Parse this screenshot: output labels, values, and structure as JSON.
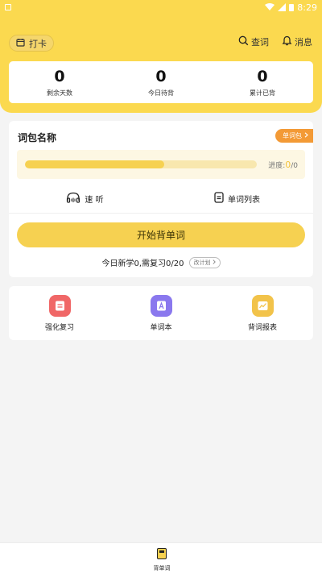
{
  "status_bar": {
    "time": "8:29"
  },
  "header": {
    "checkin_label": "打卡",
    "search_label": "查词",
    "messages_label": "消息",
    "stats": [
      {
        "value": "0",
        "label": "剩余天数"
      },
      {
        "value": "0",
        "label": "今日待背"
      },
      {
        "value": "0",
        "label": "累计已背"
      }
    ]
  },
  "wordbook": {
    "title": "词包名称",
    "tag_label": "单词包",
    "progress_label": "进度:",
    "progress_current": "0",
    "progress_total": "/0",
    "progress_fraction": 0.6,
    "listen_label": "速 听",
    "word_list_label": "单词列表",
    "start_label": "开始背单词",
    "plan_text": "今日新学0,需复习0/20",
    "change_plan_label": "改计划"
  },
  "tools": [
    {
      "label": "强化复习",
      "icon": "review-icon",
      "color": "#f06767"
    },
    {
      "label": "单词本",
      "icon": "wordbook-icon",
      "color": "#8a78ee"
    },
    {
      "label": "背词报表",
      "icon": "report-icon",
      "color": "#f2c34a"
    }
  ],
  "bottom_nav": {
    "items": [
      {
        "label": "背单词",
        "icon": "book-icon"
      }
    ]
  },
  "colors": {
    "accent": "#fbd94f",
    "tag": "#f39a36"
  }
}
